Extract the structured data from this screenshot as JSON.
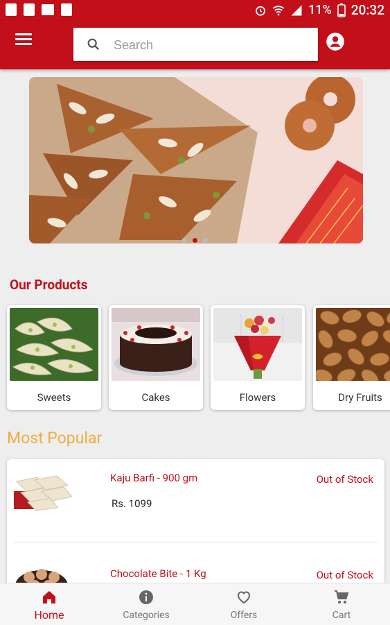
{
  "status_bar": {
    "battery_percent": "11%",
    "time": "20:32"
  },
  "search": {
    "placeholder": "Search"
  },
  "banner": {
    "slide_count": 3,
    "active_slide": 2
  },
  "products": {
    "title": "Our Products",
    "items": [
      {
        "label": "Sweets"
      },
      {
        "label": "Cakes"
      },
      {
        "label": "Flowers"
      },
      {
        "label": "Dry Fruits"
      }
    ]
  },
  "popular": {
    "title": "Most Popular",
    "items": [
      {
        "name": "Kaju Barfi - 900 gm",
        "stock": "Out of Stock",
        "price": "Rs. 1099"
      },
      {
        "name": "Chocolate Bite - 1 Kg",
        "stock": "Out of Stock"
      }
    ]
  },
  "bottom_nav": {
    "items": [
      {
        "label": "Home",
        "icon": "home-icon",
        "active": true
      },
      {
        "label": "Categories",
        "icon": "info-icon"
      },
      {
        "label": "Offers",
        "icon": "heart-icon"
      },
      {
        "label": "Cart",
        "icon": "cart-icon"
      }
    ]
  },
  "colors": {
    "brand": "#c20f1a",
    "accent": "#f0ad3d",
    "background": "#eeeeee"
  }
}
